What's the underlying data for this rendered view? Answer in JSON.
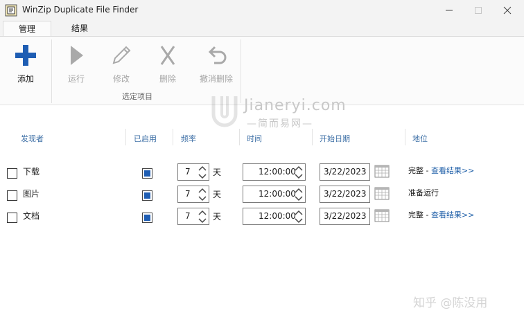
{
  "window": {
    "title": "WinZip Duplicate File Finder"
  },
  "tabs": [
    {
      "label": "管理",
      "active": true
    },
    {
      "label": "结果",
      "active": false
    }
  ],
  "ribbon": {
    "add_label": "添加",
    "run_label": "运行",
    "edit_label": "修改",
    "delete_label": "删除",
    "undo_delete_label": "撤消删除",
    "group_label": "选定项目"
  },
  "table": {
    "headers": {
      "finder": "发现者",
      "enabled": "已启用",
      "frequency": "频率",
      "time": "时间",
      "start_date": "开始日期",
      "location": "地位"
    },
    "rows": [
      {
        "name": "下载",
        "checked": false,
        "enabled": true,
        "frequency": "7",
        "unit": "天",
        "time": "12:00:00",
        "date": "3/22/2023",
        "status": "完整",
        "separator": " - ",
        "link": "查看结果>>"
      },
      {
        "name": "图片",
        "checked": false,
        "enabled": true,
        "frequency": "7",
        "unit": "天",
        "time": "12:00:00",
        "date": "3/22/2023",
        "status": "准备运行",
        "separator": "",
        "link": ""
      },
      {
        "name": "文档",
        "checked": false,
        "enabled": true,
        "frequency": "7",
        "unit": "天",
        "time": "12:00:00",
        "date": "3/22/2023",
        "status": "完整",
        "separator": " - ",
        "link": "查看结果>>"
      }
    ]
  },
  "watermark": {
    "site": "Jianeryi.com",
    "tagline": "—简而易网—",
    "credit": "知乎 @陈没用"
  },
  "colors": {
    "accent": "#1e5db3",
    "header_text": "#3d6fa6",
    "link": "#1f5fa8",
    "disabled": "#a6a6a6"
  }
}
